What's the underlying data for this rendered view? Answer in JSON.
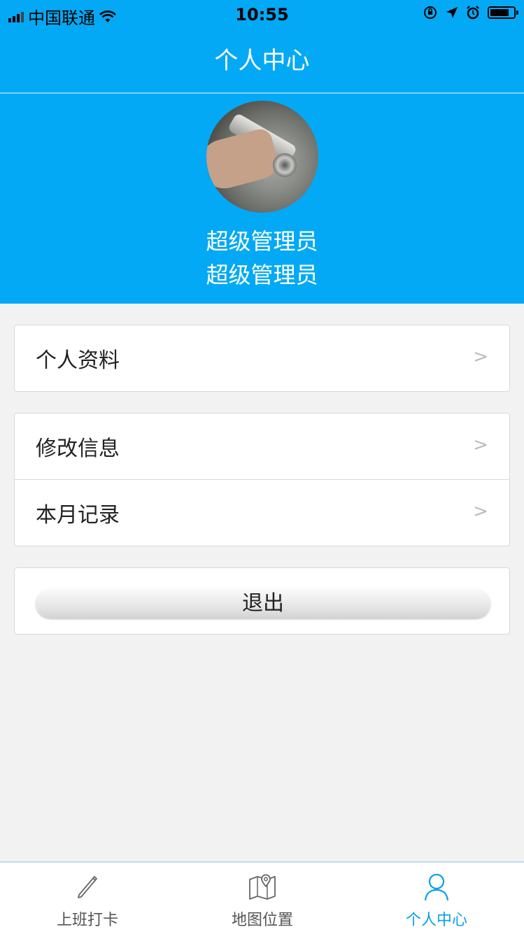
{
  "status_bar": {
    "carrier": "中国联通",
    "time": "10:55"
  },
  "nav": {
    "title": "个人中心"
  },
  "profile": {
    "name": "超级管理员",
    "role": "超级管理员"
  },
  "menu": {
    "group1": [
      {
        "label": "个人资料",
        "arrow": ">"
      }
    ],
    "group2": [
      {
        "label": "修改信息",
        "arrow": ">"
      },
      {
        "label": "本月记录",
        "arrow": ">"
      }
    ],
    "logout_label": "退出"
  },
  "tabbar": {
    "items": [
      {
        "label": "上班打卡",
        "icon": "pencil-icon"
      },
      {
        "label": "地图位置",
        "icon": "map-icon"
      },
      {
        "label": "个人中心",
        "icon": "person-icon"
      }
    ],
    "active_index": 2,
    "colors": {
      "active": "#0aa0e8",
      "inactive": "#555555"
    }
  },
  "colors": {
    "brand": "#03a9f4",
    "background": "#f2f2f2"
  }
}
